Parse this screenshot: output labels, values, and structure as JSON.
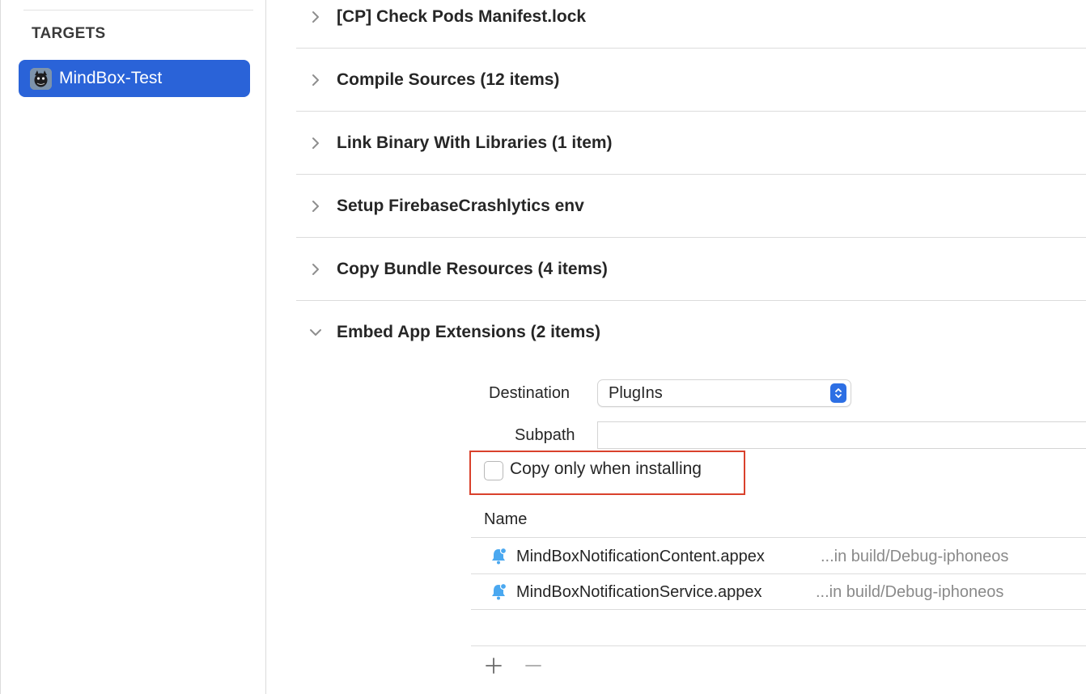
{
  "sidebar": {
    "section_header": "TARGETS",
    "target": {
      "label": "MindBox-Test",
      "icon": "app-icon"
    }
  },
  "build_phases": [
    {
      "title": "[CP] Check Pods Manifest.lock",
      "expanded": false
    },
    {
      "title": "Compile Sources (12 items)",
      "expanded": false
    },
    {
      "title": "Link Binary With Libraries (1 item)",
      "expanded": false
    },
    {
      "title": "Setup FirebaseCrashlytics env",
      "expanded": false
    },
    {
      "title": "Copy Bundle Resources (4 items)",
      "expanded": false
    },
    {
      "title": "Embed App Extensions (2 items)",
      "expanded": true
    }
  ],
  "embed": {
    "destination_label": "Destination",
    "destination_value": "PlugIns",
    "subpath_label": "Subpath",
    "subpath_value": "",
    "copy_only_label": "Copy only when installing",
    "copy_only_checked": false,
    "table": {
      "column_name": "Name",
      "rows": [
        {
          "name": "MindBoxNotificationContent.appex",
          "location": "...in build/Debug-iphoneos",
          "icon": "notification-bell-icon"
        },
        {
          "name": "MindBoxNotificationService.appex",
          "location": "...in build/Debug-iphoneos",
          "icon": "notification-bell-icon"
        }
      ]
    }
  },
  "colors": {
    "accent": "#2a63d8",
    "highlight": "#d9412c",
    "stepper": "#2d6fe4",
    "bell": "#4aa8f0"
  }
}
